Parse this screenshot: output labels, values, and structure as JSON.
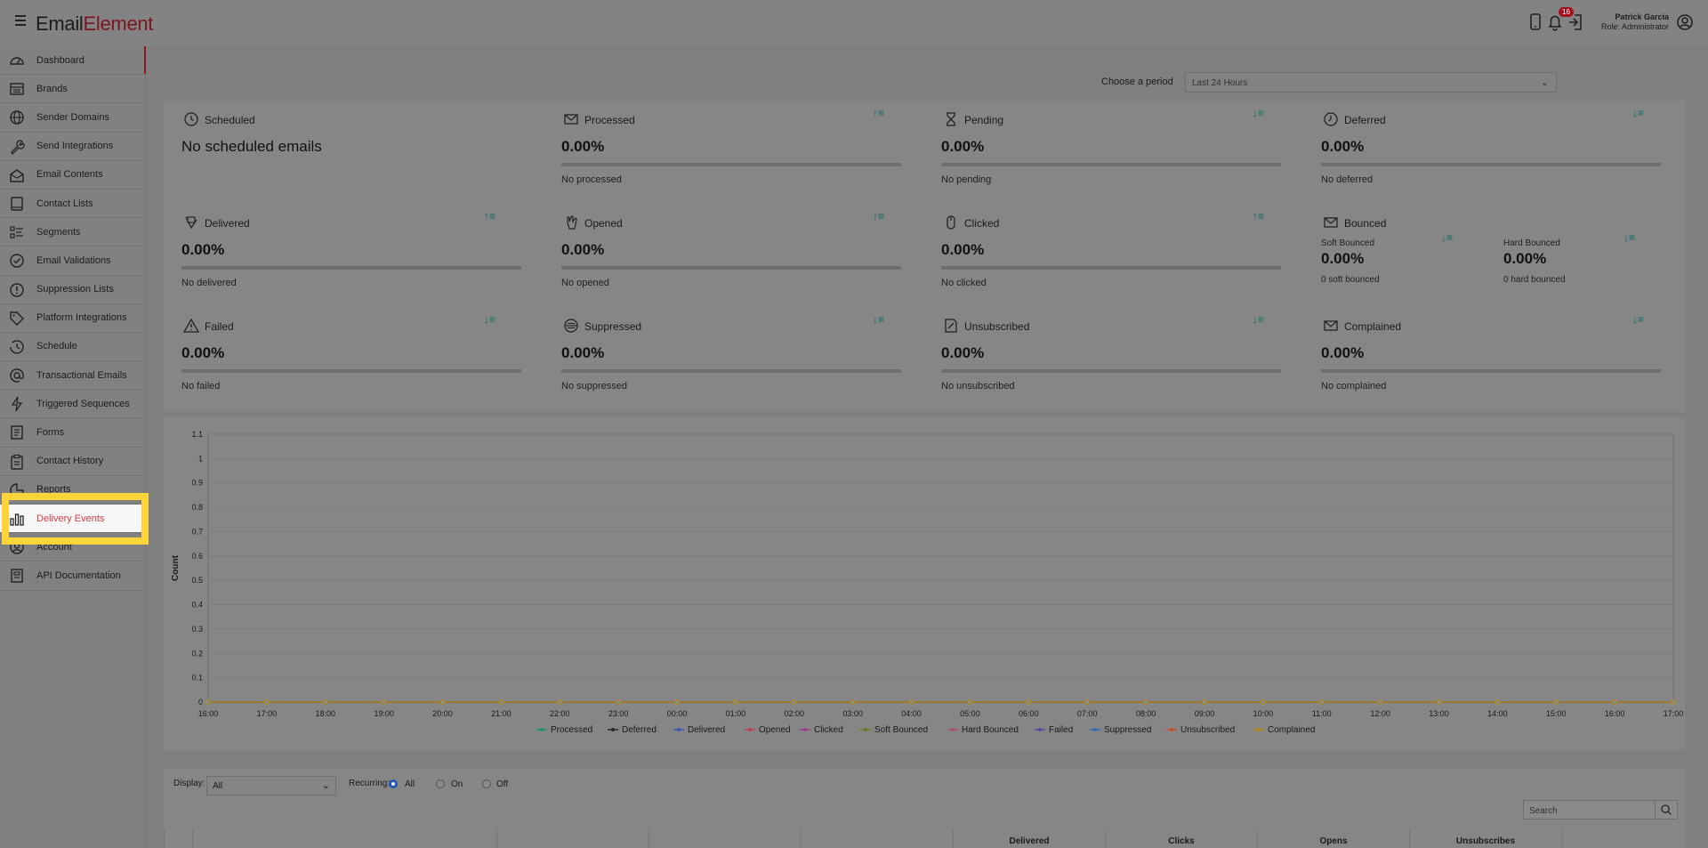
{
  "app": {
    "logo_part1": "Email",
    "logo_part2": "Element",
    "notification_count": "16",
    "user_name": "Patrick Garcia",
    "user_role": "Role: Administrator"
  },
  "sidebar": {
    "items": [
      {
        "label": "Dashboard",
        "icon": "speedometer-icon"
      },
      {
        "label": "Brands",
        "icon": "list-icon"
      },
      {
        "label": "Sender Domains",
        "icon": "globe-icon"
      },
      {
        "label": "Send Integrations",
        "icon": "wrench-icon"
      },
      {
        "label": "Email Contents",
        "icon": "envelope-open-icon"
      },
      {
        "label": "Contact Lists",
        "icon": "book-icon"
      },
      {
        "label": "Segments",
        "icon": "segments-icon"
      },
      {
        "label": "Email Validations",
        "icon": "check-circle-icon"
      },
      {
        "label": "Suppression Lists",
        "icon": "exclamation-circle-icon"
      },
      {
        "label": "Platform Integrations",
        "icon": "tag-icon"
      },
      {
        "label": "Schedule",
        "icon": "clock-icon"
      },
      {
        "label": "Transactional Emails",
        "icon": "at-icon"
      },
      {
        "label": "Triggered Sequences",
        "icon": "lightning-icon"
      },
      {
        "label": "Forms",
        "icon": "form-icon"
      },
      {
        "label": "Contact History",
        "icon": "clipboard-icon"
      },
      {
        "label": "Reports",
        "icon": "pie-chart-icon"
      },
      {
        "label": "Delivery Events",
        "icon": "bar-chart-icon"
      },
      {
        "label": "Account",
        "icon": "user-circle-icon"
      },
      {
        "label": "API Documentation",
        "icon": "document-icon"
      }
    ],
    "active": "Delivery Events",
    "highlight_color": "#ffd43b",
    "accent_color": "#d13b49"
  },
  "period": {
    "label": "Choose a period",
    "value": "Last 24 Hours"
  },
  "cards": {
    "scheduled": {
      "title": "Scheduled",
      "value": "No scheduled emails"
    },
    "processed": {
      "title": "Processed",
      "value": "0.00%",
      "sub": "No processed"
    },
    "pending": {
      "title": "Pending",
      "value": "0.00%",
      "sub": "No pending"
    },
    "deferred": {
      "title": "Deferred",
      "value": "0.00%",
      "sub": "No deferred"
    },
    "delivered": {
      "title": "Delivered",
      "value": "0.00%",
      "sub": "No delivered"
    },
    "opened": {
      "title": "Opened",
      "value": "0.00%",
      "sub": "No opened"
    },
    "clicked": {
      "title": "Clicked",
      "value": "0.00%",
      "sub": "No clicked"
    },
    "bounced": {
      "title": "Bounced",
      "soft_label": "Soft Bounced",
      "soft_value": "0.00%",
      "soft_sub": "0 soft bounced",
      "hard_label": "Hard Bounced",
      "hard_value": "0.00%",
      "hard_sub": "0 hard bounced"
    },
    "failed": {
      "title": "Failed",
      "value": "0.00%",
      "sub": "No failed"
    },
    "suppressed": {
      "title": "Suppressed",
      "value": "0.00%",
      "sub": "No suppressed"
    },
    "unsubscribed": {
      "title": "Unsubscribed",
      "value": "0.00%",
      "sub": "No unsubscribed"
    },
    "complained": {
      "title": "Complained",
      "value": "0.00%",
      "sub": "No complained"
    }
  },
  "chart_data": {
    "type": "line",
    "ylabel": "Count",
    "xlabel": "",
    "ylim": [
      0,
      1.1
    ],
    "y_ticks": [
      "0",
      "0.1",
      "0.2",
      "0.3",
      "0.4",
      "0.5",
      "0.6",
      "0.7",
      "0.8",
      "0.9",
      "1",
      "1.1"
    ],
    "categories": [
      "16:00",
      "17:00",
      "18:00",
      "19:00",
      "20:00",
      "21:00",
      "22:00",
      "23:00",
      "00:00",
      "01:00",
      "02:00",
      "03:00",
      "04:00",
      "05:00",
      "06:00",
      "07:00",
      "08:00",
      "09:00",
      "10:00",
      "11:00",
      "12:00",
      "13:00",
      "14:00",
      "15:00",
      "16:00",
      "17:00"
    ],
    "series": [
      {
        "name": "Processed",
        "color": "#1f8f6f",
        "values": [
          0,
          0,
          0,
          0,
          0,
          0,
          0,
          0,
          0,
          0,
          0,
          0,
          0,
          0,
          0,
          0,
          0,
          0,
          0,
          0,
          0,
          0,
          0,
          0,
          0,
          0
        ]
      },
      {
        "name": "Deferred",
        "color": "#2a2a2a",
        "values": [
          0,
          0,
          0,
          0,
          0,
          0,
          0,
          0,
          0,
          0,
          0,
          0,
          0,
          0,
          0,
          0,
          0,
          0,
          0,
          0,
          0,
          0,
          0,
          0,
          0,
          0
        ]
      },
      {
        "name": "Delivered",
        "color": "#3b5bb5",
        "values": [
          0,
          0,
          0,
          0,
          0,
          0,
          0,
          0,
          0,
          0,
          0,
          0,
          0,
          0,
          0,
          0,
          0,
          0,
          0,
          0,
          0,
          0,
          0,
          0,
          0,
          0
        ]
      },
      {
        "name": "Opened",
        "color": "#c0405a",
        "values": [
          0,
          0,
          0,
          0,
          0,
          0,
          0,
          0,
          0,
          0,
          0,
          0,
          0,
          0,
          0,
          0,
          0,
          0,
          0,
          0,
          0,
          0,
          0,
          0,
          0,
          0
        ]
      },
      {
        "name": "Clicked",
        "color": "#9b3d8a",
        "values": [
          0,
          0,
          0,
          0,
          0,
          0,
          0,
          0,
          0,
          0,
          0,
          0,
          0,
          0,
          0,
          0,
          0,
          0,
          0,
          0,
          0,
          0,
          0,
          0,
          0,
          0
        ]
      },
      {
        "name": "Soft Bounced",
        "color": "#6b7a22",
        "values": [
          0,
          0,
          0,
          0,
          0,
          0,
          0,
          0,
          0,
          0,
          0,
          0,
          0,
          0,
          0,
          0,
          0,
          0,
          0,
          0,
          0,
          0,
          0,
          0,
          0,
          0
        ]
      },
      {
        "name": "Hard Bounced",
        "color": "#a05070",
        "values": [
          0,
          0,
          0,
          0,
          0,
          0,
          0,
          0,
          0,
          0,
          0,
          0,
          0,
          0,
          0,
          0,
          0,
          0,
          0,
          0,
          0,
          0,
          0,
          0,
          0,
          0
        ]
      },
      {
        "name": "Failed",
        "color": "#5a4aa5",
        "values": [
          0,
          0,
          0,
          0,
          0,
          0,
          0,
          0,
          0,
          0,
          0,
          0,
          0,
          0,
          0,
          0,
          0,
          0,
          0,
          0,
          0,
          0,
          0,
          0,
          0,
          0
        ]
      },
      {
        "name": "Suppressed",
        "color": "#3a6ab0",
        "values": [
          0,
          0,
          0,
          0,
          0,
          0,
          0,
          0,
          0,
          0,
          0,
          0,
          0,
          0,
          0,
          0,
          0,
          0,
          0,
          0,
          0,
          0,
          0,
          0,
          0,
          0
        ]
      },
      {
        "name": "Unsubscribed",
        "color": "#c0502a",
        "values": [
          0,
          0,
          0,
          0,
          0,
          0,
          0,
          0,
          0,
          0,
          0,
          0,
          0,
          0,
          0,
          0,
          0,
          0,
          0,
          0,
          0,
          0,
          0,
          0,
          0,
          0
        ]
      },
      {
        "name": "Complained",
        "color": "#b08a10",
        "values": [
          0,
          0,
          0,
          0,
          0,
          0,
          0,
          0,
          0,
          0,
          0,
          0,
          0,
          0,
          0,
          0,
          0,
          0,
          0,
          0,
          0,
          0,
          0,
          0,
          0,
          0
        ]
      }
    ],
    "grid": true,
    "legend_position": "bottom"
  },
  "filters": {
    "display_label": "Display:",
    "display_value": "All",
    "recurring_label": "Recurring:",
    "options": [
      "All",
      "On",
      "Off"
    ],
    "selected": "All",
    "search_placeholder": "Search"
  },
  "table": {
    "headers": [
      "Delivered",
      "Clicks",
      "Opens",
      "Unsubscribes"
    ]
  }
}
